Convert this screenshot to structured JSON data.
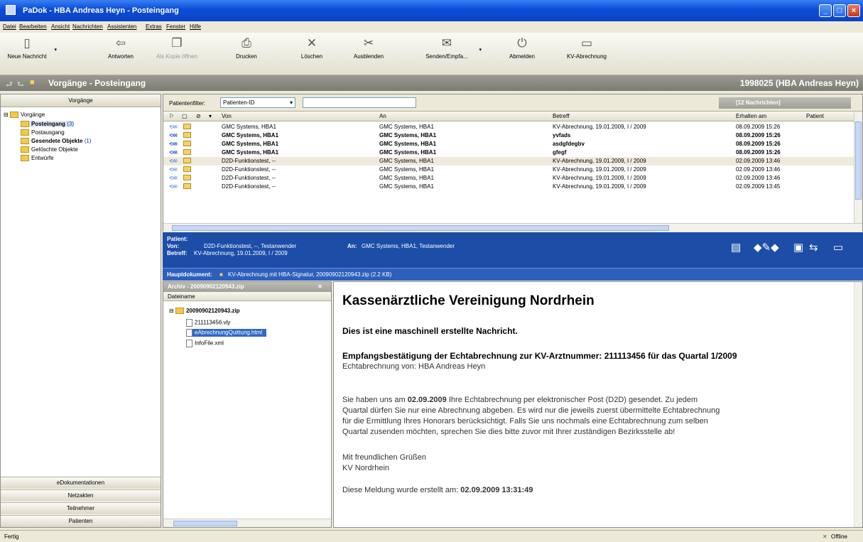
{
  "window": {
    "title": "PaDok - HBA Andreas Heyn - Posteingang"
  },
  "menu": [
    "Datei",
    "Bearbeiten",
    "Ansicht",
    "Nachrichten",
    "Assistenten",
    "Extras",
    "Fenster",
    "Hilfe"
  ],
  "toolbar": {
    "new_message": "Neue Nachricht",
    "reply": "Antworten",
    "open_copy": "Als Kopie öffnen",
    "print": "Drucken",
    "delete": "Löschen",
    "hide": "Ausblenden",
    "send_receive": "Senden/Empfa...",
    "logout": "Abmelden",
    "kv_billing": "KV-Abrechnung"
  },
  "navbar": {
    "title": "Vorgänge - Posteingang",
    "user": "1998025 (HBA Andreas Heyn)"
  },
  "sidebar": {
    "header": "Vorgänge",
    "root": "Vorgänge",
    "items": [
      {
        "label": "Posteingang",
        "count": "(3)"
      },
      {
        "label": "Postausgang",
        "count": ""
      },
      {
        "label": "Gesendete Objekte",
        "count": "(1)"
      },
      {
        "label": "Gelöschte Objekte",
        "count": ""
      },
      {
        "label": "Entwürfe",
        "count": ""
      }
    ],
    "bottom_buttons": [
      "eDokumentationen",
      "Netzakten",
      "Teilnehmer",
      "Patienten"
    ]
  },
  "filter": {
    "label": "Patientenfilter:",
    "select": "Patienten-ID",
    "count": "[12 Nachrichten]"
  },
  "columns": {
    "von": "Von",
    "an": "An",
    "betreff": "Betreff",
    "erhalten": "Erhalten am",
    "patient": "Patient"
  },
  "messages": [
    {
      "from": "GMC Systems, HBA1",
      "to": "GMC Systems, HBA1",
      "subject": "KV-Abrechnung, 19.01.2009, I / 2009",
      "received": "08.09.2009 15:26",
      "unread": false,
      "selected": false
    },
    {
      "from": "GMC Systems, HBA1",
      "to": "GMC Systems, HBA1",
      "subject": "yvfads",
      "received": "08.09.2009 15:26",
      "unread": true,
      "selected": false
    },
    {
      "from": "GMC Systems, HBA1",
      "to": "GMC Systems, HBA1",
      "subject": "asdgfdegbv",
      "received": "08.09.2009 15:26",
      "unread": true,
      "selected": false
    },
    {
      "from": "GMC Systems, HBA1",
      "to": "GMC Systems, HBA1",
      "subject": "gfegf",
      "received": "08.09.2009 15:26",
      "unread": true,
      "selected": false
    },
    {
      "from": "D2D-Funktionstest, --",
      "to": "GMC Systems, HBA1",
      "subject": "KV-Abrechnung, 19.01.2009, I / 2009",
      "received": "02.09.2009 13:46",
      "unread": false,
      "selected": true
    },
    {
      "from": "D2D-Funktionstest, --",
      "to": "GMC Systems, HBA1",
      "subject": "KV-Abrechnung, 19.01.2009, I / 2009",
      "received": "02.09.2009 13:46",
      "unread": false,
      "selected": false
    },
    {
      "from": "D2D-Funktionstest, --",
      "to": "GMC Systems, HBA1",
      "subject": "KV-Abrechnung, 19.01.2009, I / 2009",
      "received": "02.09.2009 13:46",
      "unread": false,
      "selected": false
    },
    {
      "from": "D2D-Funktionstest, --",
      "to": "GMC Systems, HBA1",
      "subject": "KV-Abrechnung, 19.01.2009, I / 2009",
      "received": "02.09.2009 13:45",
      "unread": false,
      "selected": false
    }
  ],
  "preview": {
    "patient_label": "Patient:",
    "from_label": "Von:",
    "from": "D2D-Funktionstest, --, Testanwender",
    "to_label": "An:",
    "to": "GMC Systems, HBA1, Testanwender",
    "subject_label": "Betreff:",
    "subject": "KV-Abrechnung, 19.01.2009, I / 2009",
    "main_doc_label": "Hauptdokument:",
    "main_doc": "KV-Abrechnung mit HBA-Signatur, 20090902120943.zip (2.2 KB)"
  },
  "archive": {
    "title": "Archiv - 20090902120943.zip",
    "column": "Dateiname",
    "zip": "20090902120943.zip",
    "files": [
      "211113456.vly",
      "eAbrechnungQuittung.html",
      "InfoFile.xml"
    ]
  },
  "document": {
    "heading": "Kassenärztliche Vereinigung Nordrhein",
    "auto_note": "Dies ist eine maschinell erstellte Nachricht.",
    "subheading": "Empfangsbestätigung der Echtabrechnung zur KV-Arztnummer: 211113456  für das Quartal 1/2009",
    "billing_from": "Echtabrechnung von: HBA Andreas Heyn",
    "body_1a": "Sie haben uns am ",
    "body_date": "02.09.2009",
    "body_1b": " Ihre Echtabrechnung per elektronischer Post (D2D) gesendet. Zu jedem",
    "body_2": "Quartal dürfen Sie nur eine Abrechnung abgeben. Es wird nur die jeweils zuerst übermittelte Echtabrechnung",
    "body_3": "für die Ermittlung Ihres Honorars berücksichtigt. Falls Sie uns nochmals eine Echtabrechnung zum selben",
    "body_4": "Quartal zusenden möchten, sprechen Sie dies bitte zuvor mit Ihrer zuständigen Bezirksstelle ab!",
    "greeting": "Mit freundlichen Grüßen",
    "sender": "KV Nordrhein",
    "created_label": "Diese Meldung wurde erstellt am: ",
    "created_value": "02.09.2009 13:31:49"
  },
  "status": {
    "left": "Fertig",
    "right": "Offline"
  },
  "colors": {
    "title_blue": "#0a4bd8",
    "preview_blue": "#1c4ea8",
    "selection_blue": "#316ac5",
    "panel_bg": "#ece9d8"
  }
}
